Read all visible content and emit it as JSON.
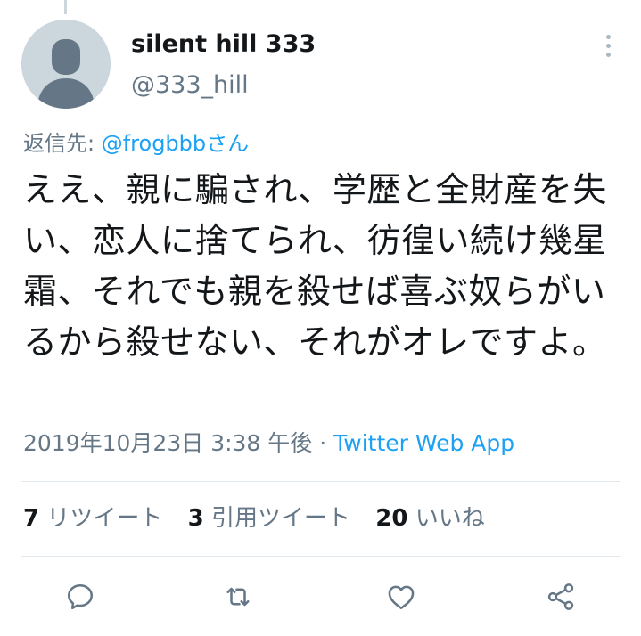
{
  "user": {
    "display_name": "silent hill 333",
    "handle": "@333_hill"
  },
  "reply": {
    "prefix": "返信先: ",
    "mention": "@frogbbbさん"
  },
  "tweet": {
    "text": "ええ、親に騙され、学歴と全財産を失い、恋人に捨てられ、彷徨い続け幾星霜、それでも親を殺せば喜ぶ奴らがいるから殺せない、それがオレですよ。"
  },
  "meta": {
    "timestamp": "2019年10月23日 3:38 午後",
    "separator": " · ",
    "source": "Twitter Web App"
  },
  "stats": {
    "retweets_count": "7",
    "retweets_label": "リツイート",
    "quotes_count": "3",
    "quotes_label": "引用ツイート",
    "likes_count": "20",
    "likes_label": "いいね"
  },
  "actions": [
    {
      "icon": "reply-icon"
    },
    {
      "icon": "retweet-icon"
    },
    {
      "icon": "like-icon"
    },
    {
      "icon": "share-icon"
    }
  ],
  "colors": {
    "accent": "#1da1f2",
    "secondary_text": "#657786",
    "primary_text": "#14171a",
    "divider": "#e1e8ed",
    "avatar_bg": "#ccd6dd"
  }
}
